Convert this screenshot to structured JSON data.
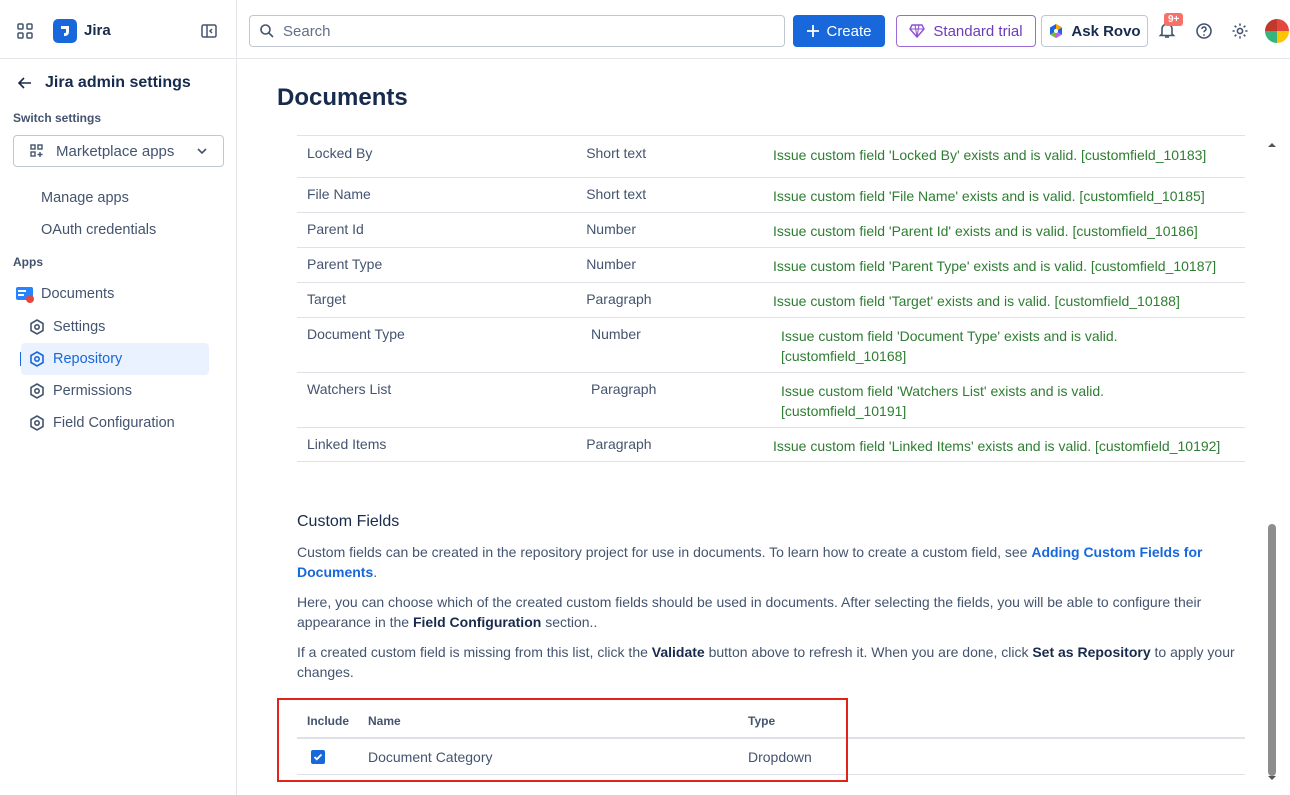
{
  "header": {
    "app_name": "Jira",
    "search_placeholder": "Search",
    "create_label": "Create",
    "trial_label": "Standard trial",
    "rovo_label": "Ask Rovo",
    "notifications_badge": "9+"
  },
  "sidebar": {
    "back_title": "Jira admin settings",
    "switch_label": "Switch settings",
    "switch_value": "Marketplace apps",
    "items": [
      "Manage apps",
      "OAuth credentials"
    ],
    "apps_label": "Apps",
    "app_name": "Documents",
    "sub_items": [
      "Settings",
      "Repository",
      "Permissions",
      "Field Configuration"
    ],
    "active_item": "Repository"
  },
  "main": {
    "title": "Documents",
    "fields": [
      {
        "name": "Locked By",
        "type": "Short text",
        "status": "Issue custom field 'Locked By' exists and is valid. [customfield_10183]"
      },
      {
        "name": "File Name",
        "type": "Short text",
        "status": "Issue custom field 'File Name' exists and is valid. [customfield_10185]"
      },
      {
        "name": "Parent Id",
        "type": "Number",
        "status": "Issue custom field 'Parent Id' exists and is valid. [customfield_10186]"
      },
      {
        "name": "Parent Type",
        "type": "Number",
        "status": "Issue custom field 'Parent Type' exists and is valid. [customfield_10187]"
      },
      {
        "name": "Target",
        "type": "Paragraph",
        "status": "Issue custom field 'Target' exists and is valid. [customfield_10188]"
      },
      {
        "name": "Document Type",
        "type": "Number",
        "status": "Issue custom field 'Document Type' exists and is valid. [customfield_10168]"
      },
      {
        "name": "Watchers List",
        "type": "Paragraph",
        "status": "Issue custom field 'Watchers List' exists and is valid. [customfield_10191]"
      },
      {
        "name": "Linked Items",
        "type": "Paragraph",
        "status": "Issue custom field 'Linked Items' exists and is valid. [customfield_10192]"
      }
    ],
    "custom_fields": {
      "title": "Custom Fields",
      "p1_text": "Custom fields can be created in the repository project for use in documents. To learn how to create a custom field, see ",
      "p1_link": "Adding Custom Fields for Documents",
      "p1_end": ".",
      "p2_text": "Here, you can choose which of the created custom fields should be used in documents. After selecting the fields, you will be able to configure their appearance in the ",
      "p2_bold": "Field Configuration",
      "p2_end": " section..",
      "p3_text": "If a created custom field is missing from this list, click the ",
      "p3_bold1": "Validate",
      "p3_mid": " button above to refresh it. When you are done, click ",
      "p3_bold2": "Set as Repository",
      "p3_end": " to apply your changes.",
      "columns": {
        "include": "Include",
        "name": "Name",
        "type": "Type"
      },
      "rows": [
        {
          "included": true,
          "name": "Document Category",
          "type": "Dropdown"
        }
      ]
    }
  }
}
